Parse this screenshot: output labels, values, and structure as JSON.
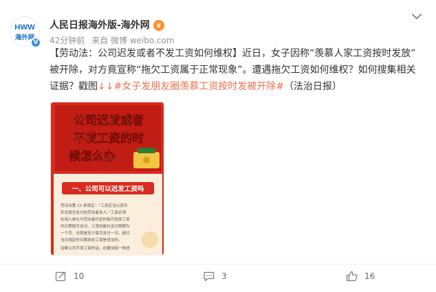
{
  "author": {
    "name": "人民日报海外版-海外网",
    "avatar_label": "海外网",
    "avatar_logo": "HWW"
  },
  "meta": {
    "time": "42分钟前",
    "source": "来自 微博 weibo.com"
  },
  "post": {
    "bracket_title": "【劳动法：公司迟发或者不发工资如何维权】",
    "text1": "近日，女子因称",
    "quote1": "“羡慕人家工资按时发放”",
    "text2": "被开除，对方竟宣称",
    "quote2": "“拖欠工资属于正常现象”",
    "text3": "。遭遇拖欠工资如何维权？如何搜集相关证据？戳图",
    "arrows": "↓↓",
    "topic": "#女子发朋友圈羡慕工资按时发被开除#",
    "source_tag": "（法治日报）"
  },
  "image": {
    "title_line1": "公司迟发或者",
    "title_line2": "不发工资的时",
    "title_line3": "候怎么办",
    "section_heading": "一、公司可以迟发工资吗",
    "body_line1": "劳动法第 15 条规定：“工资应当以货币",
    "body_line2": "形式按月支付给劳动者本人。”工资必须",
    "body_line3": "在用人单位与劳动者约定的每月发放工资",
    "body_line4": "的日期按月支付。工资的最长支付周期为",
    "body_line5": "一个月，也就是至少每月支付一次。超过",
    "body_line6": "当月规定的日期发放工资是违法的。",
    "body_line7": "如果公司不发工资的话，还要加赔一种违"
  },
  "actions": {
    "forward_count": "10",
    "comment_count": "3",
    "like_count": "16"
  },
  "colors": {
    "accent": "#eb7350",
    "poster_red": "#d92b1f",
    "verify_blue": "#3b8fe3"
  }
}
